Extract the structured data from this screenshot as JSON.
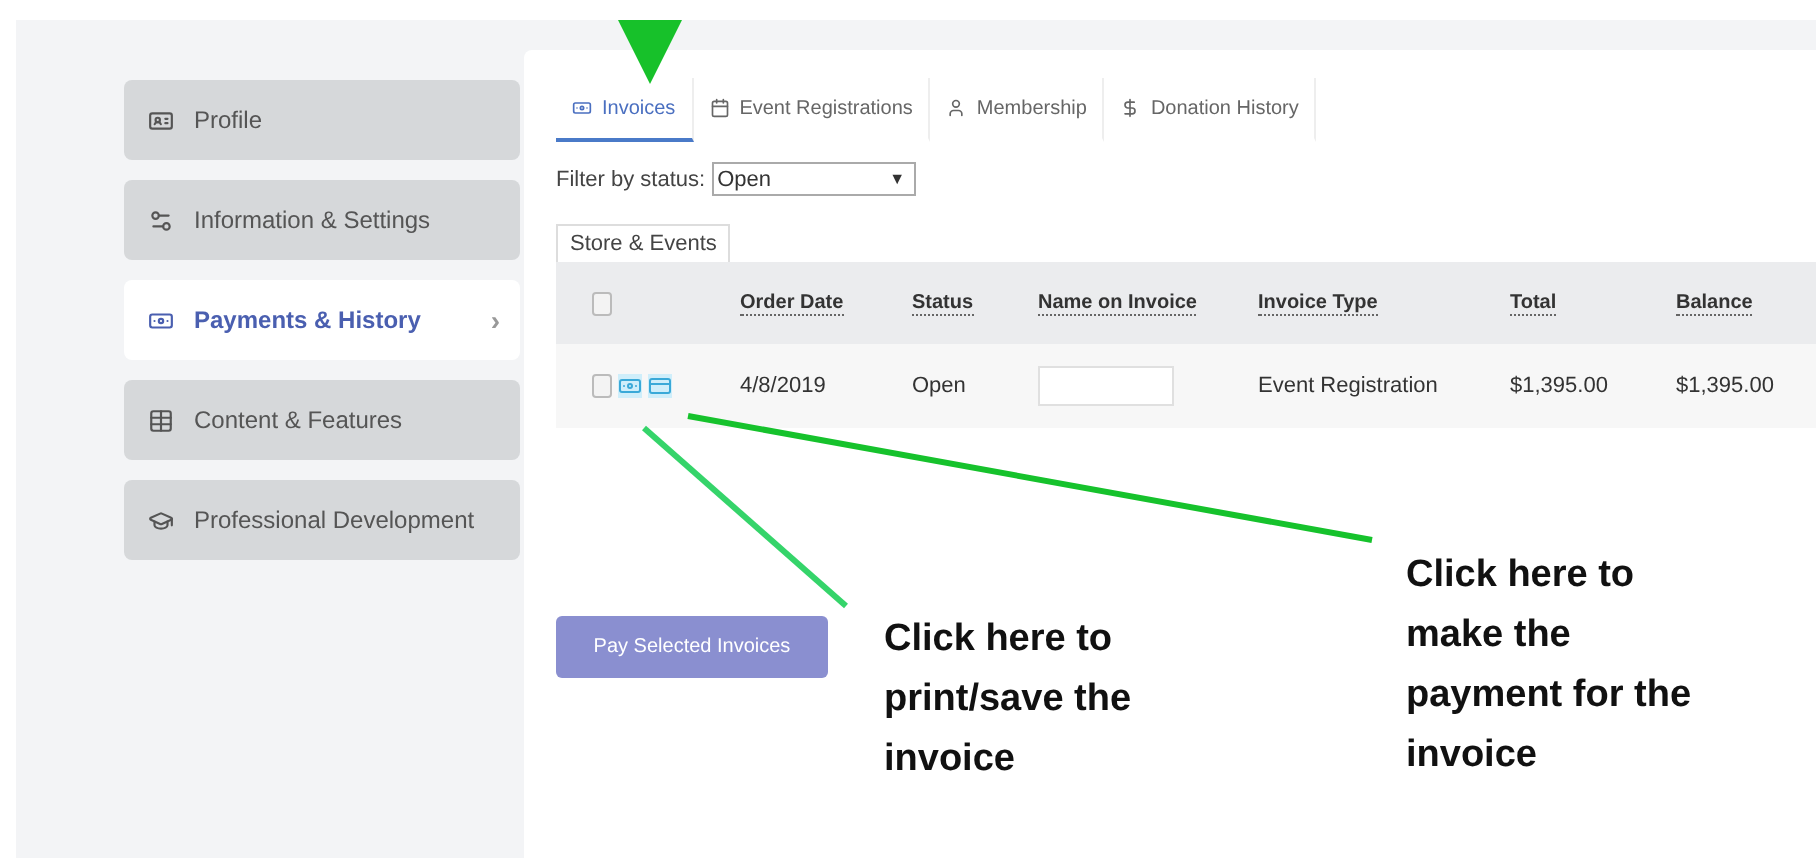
{
  "sidebar": {
    "items": [
      {
        "label": "Profile",
        "selected": false
      },
      {
        "label": "Information & Settings",
        "selected": false
      },
      {
        "label": "Payments & History",
        "selected": true,
        "chevron": "›"
      },
      {
        "label": "Content & Features",
        "selected": false
      },
      {
        "label": "Professional Development",
        "selected": false
      }
    ]
  },
  "tabs": [
    {
      "label": "Invoices",
      "selected": true
    },
    {
      "label": "Event Registrations",
      "selected": false
    },
    {
      "label": "Membership",
      "selected": false
    },
    {
      "label": "Donation History",
      "selected": false
    }
  ],
  "filter": {
    "label": "Filter by status:",
    "value": "Open",
    "caret": "▼"
  },
  "subtab": {
    "label": "Store & Events"
  },
  "table": {
    "columns": [
      "Order Date",
      "Status",
      "Name on Invoice",
      "Invoice Type",
      "Total",
      "Balance"
    ],
    "header_checked": false,
    "rows": [
      {
        "checked": false,
        "cells": [
          "4/8/2019",
          "Open",
          "",
          "Event Registration",
          "$1,395.00",
          "$1,395.00"
        ]
      }
    ]
  },
  "pay_button": "Pay Selected Invoices",
  "callouts": [
    "Click here to print/save the invoice",
    "Click here to make the payment for the invoice"
  ]
}
